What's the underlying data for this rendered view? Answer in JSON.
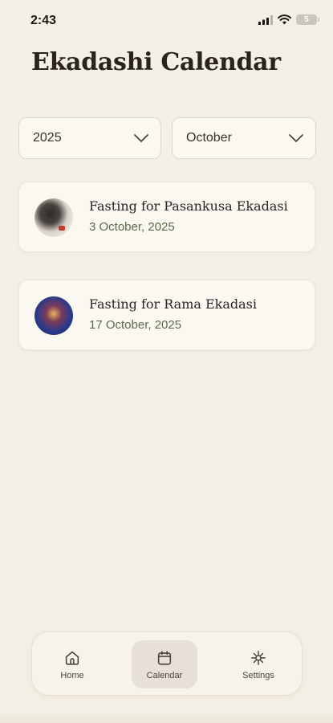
{
  "status_bar": {
    "time": "2:43",
    "battery": "5"
  },
  "page": {
    "title": "Ekadashi Calendar"
  },
  "filters": {
    "year": "2025",
    "month": "October"
  },
  "events": [
    {
      "title": "Fasting for Pasankusa Ekadasi",
      "date": "3 October, 2025"
    },
    {
      "title": "Fasting for Rama Ekadasi",
      "date": "17 October, 2025"
    }
  ],
  "nav": {
    "items": [
      {
        "label": "Home",
        "icon": "home-icon"
      },
      {
        "label": "Calendar",
        "icon": "calendar-icon",
        "active": true
      },
      {
        "label": "Settings",
        "icon": "settings-icon"
      }
    ]
  },
  "colors": {
    "background": "#f4efe4",
    "card": "#fbf8f2",
    "date_text": "#5b6a4a",
    "active_nav": "#e6e0d6"
  }
}
